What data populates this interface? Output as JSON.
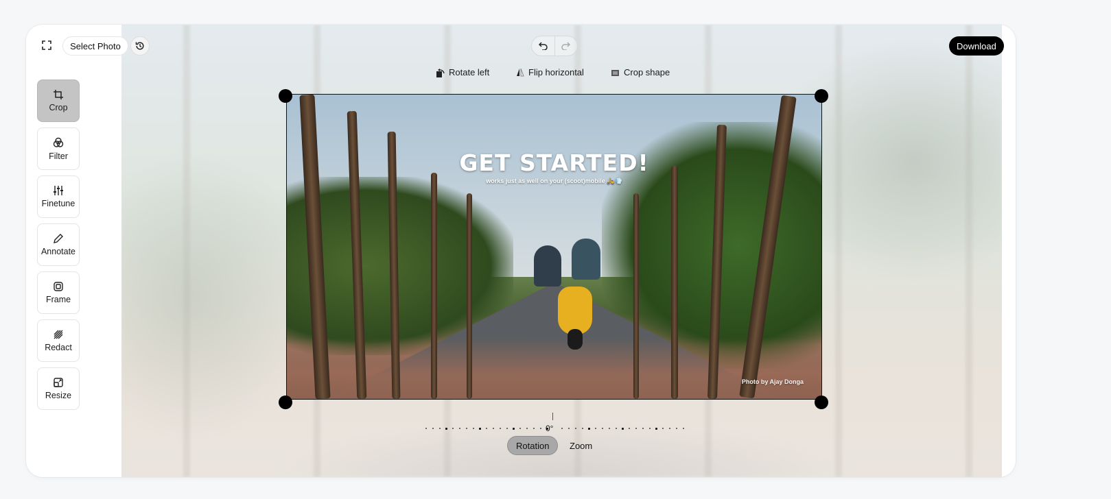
{
  "toolbar": {
    "select_photo_label": "Select Photo",
    "download_label": "Download"
  },
  "sidebar": {
    "items": [
      {
        "label": "Crop",
        "icon": "crop-icon",
        "active": true
      },
      {
        "label": "Filter",
        "icon": "filter-icon",
        "active": false
      },
      {
        "label": "Finetune",
        "icon": "sliders-icon",
        "active": false
      },
      {
        "label": "Annotate",
        "icon": "pencil-icon",
        "active": false
      },
      {
        "label": "Frame",
        "icon": "frame-icon",
        "active": false
      },
      {
        "label": "Redact",
        "icon": "redact-icon",
        "active": false
      },
      {
        "label": "Resize",
        "icon": "resize-icon",
        "active": false
      }
    ]
  },
  "crop_tools": {
    "rotate_left": "Rotate left",
    "flip_horizontal": "Flip horizontal",
    "crop_shape": "Crop shape"
  },
  "photo": {
    "headline": "GET STARTED!",
    "subline": "works just as well on your (scoot)mobile 🛵💨",
    "credit": "Photo by Ajay Donga"
  },
  "rotation": {
    "value": "0°"
  },
  "tabs": {
    "rotation": "Rotation",
    "zoom": "Zoom",
    "active": "Rotation"
  },
  "colors": {
    "accent": "#000000",
    "active_tool_bg": "#c4c4c4"
  }
}
